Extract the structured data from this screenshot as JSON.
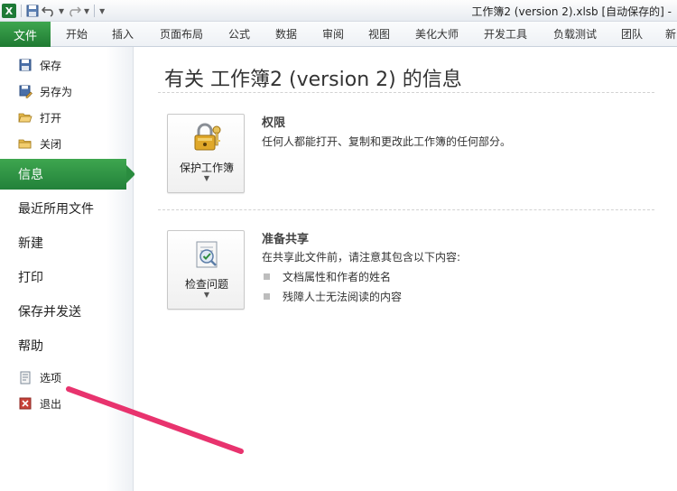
{
  "titlebar": {
    "excel_icon_letter": "X",
    "window_title": "工作簿2 (version 2).xlsb [自动保存的] -",
    "qat_icons": [
      "save-icon",
      "undo-icon",
      "redo-icon",
      "customize-qat-icon"
    ]
  },
  "ribbon": {
    "file_tab": "文件",
    "tabs": [
      "开始",
      "插入",
      "页面布局",
      "公式",
      "数据",
      "审阅",
      "视图",
      "美化大师",
      "开发工具",
      "负载测试",
      "团队",
      "新"
    ]
  },
  "leftnav": {
    "commands_top": [
      {
        "label": "保存",
        "icon": "save-icon"
      },
      {
        "label": "另存为",
        "icon": "save-as-icon"
      },
      {
        "label": "打开",
        "icon": "open-folder-icon"
      },
      {
        "label": "关闭",
        "icon": "close-folder-icon"
      }
    ],
    "tabs": [
      "信息",
      "最近所用文件",
      "新建",
      "打印",
      "保存并发送",
      "帮助"
    ],
    "active_tab": "信息",
    "commands_bottom": [
      {
        "label": "选项",
        "icon": "options-icon"
      },
      {
        "label": "退出",
        "icon": "exit-icon"
      }
    ]
  },
  "main": {
    "title": "有关 工作簿2 (version 2) 的信息",
    "permissions": {
      "button_label": "保护工作簿",
      "button_icon": "lock-key-icon",
      "heading": "权限",
      "description": "任何人都能打开、复制和更改此工作簿的任何部分。"
    },
    "prepare": {
      "button_label": "检查问题",
      "button_icon": "inspect-document-icon",
      "heading": "准备共享",
      "description": "在共享此文件前，请注意其包含以下内容:",
      "bullets": [
        "文档属性和作者的姓名",
        "残障人士无法阅读的内容"
      ]
    }
  },
  "colors": {
    "accent_green": "#2a8c3f",
    "annotation_pink": "#e8336e"
  }
}
